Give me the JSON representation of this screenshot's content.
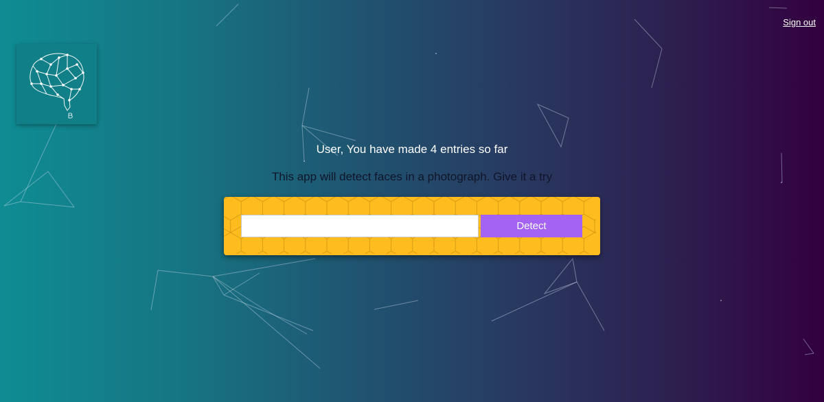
{
  "nav": {
    "signout_label": "Sign out"
  },
  "logo": {
    "icon": "brain-network-icon",
    "background_color": "#117f87"
  },
  "rank": {
    "entries_text": "User, You have made 4 entries so far"
  },
  "form": {
    "description": "This app will detect faces in a photograph. Give it a try",
    "input_value": "",
    "input_placeholder": "",
    "detect_label": "Detect",
    "panel_color": "#ffbc1f",
    "button_color": "#a463f2"
  },
  "background": {
    "gradient_start": "#0f8c93",
    "gradient_end": "#33003f"
  }
}
